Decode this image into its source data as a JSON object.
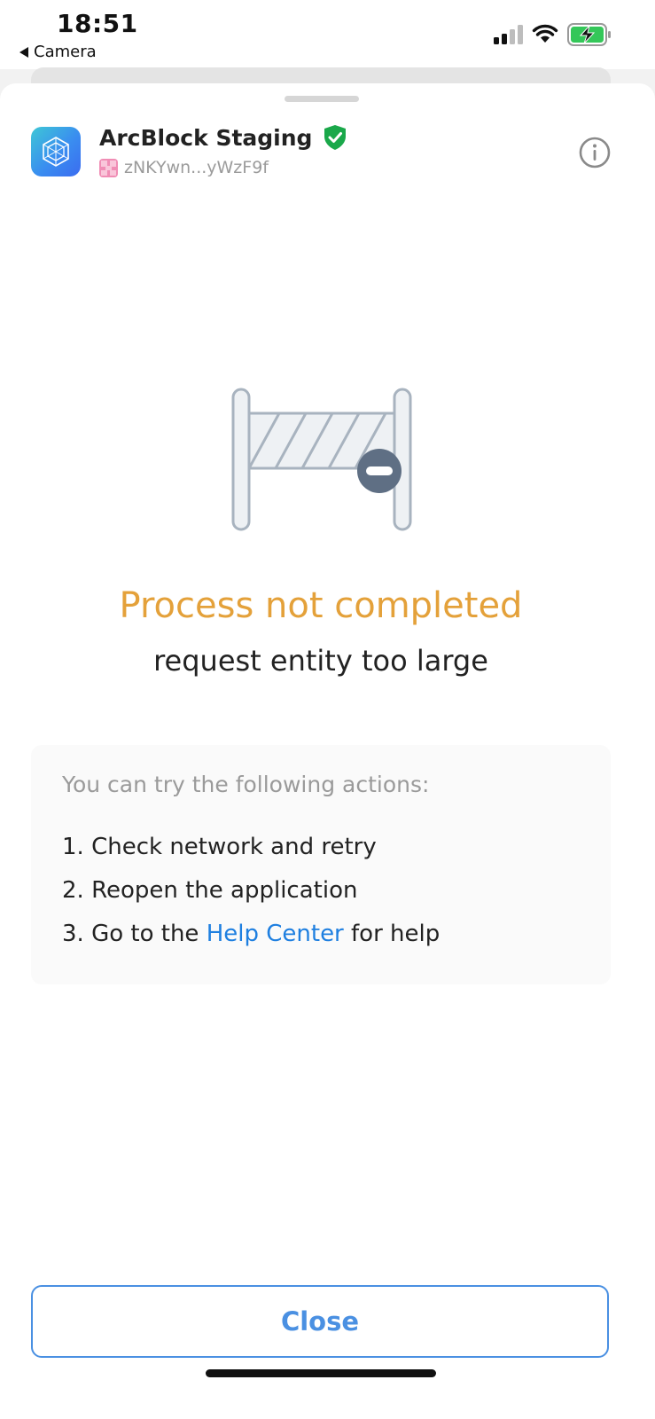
{
  "status_bar": {
    "time": "18:51",
    "back_label": "Camera",
    "icons": [
      "cellular-signal-icon",
      "wifi-icon",
      "battery-charging-icon"
    ]
  },
  "app": {
    "name": "ArcBlock Staging",
    "did": "zNKYwn...yWzF9f",
    "verified": true,
    "icons": [
      "arcblock-logo-icon",
      "verified-shield-icon",
      "did-avatar-icon",
      "info-icon"
    ]
  },
  "error": {
    "illustration": "barrier-icon",
    "title": "Process not completed",
    "message": "request entity too large"
  },
  "actions": {
    "heading": "You can try the following actions:",
    "items": [
      {
        "text": "1. Check network and retry"
      },
      {
        "text": "2. Reopen the application"
      },
      {
        "prefix": "3. Go to the ",
        "link": "Help Center",
        "suffix": " for help"
      }
    ]
  },
  "footer": {
    "close_label": "Close"
  },
  "colors": {
    "error_title": "#e4a13a",
    "link": "#1e7fe0",
    "button": "#4a90e2",
    "verified": "#1aa84a"
  }
}
